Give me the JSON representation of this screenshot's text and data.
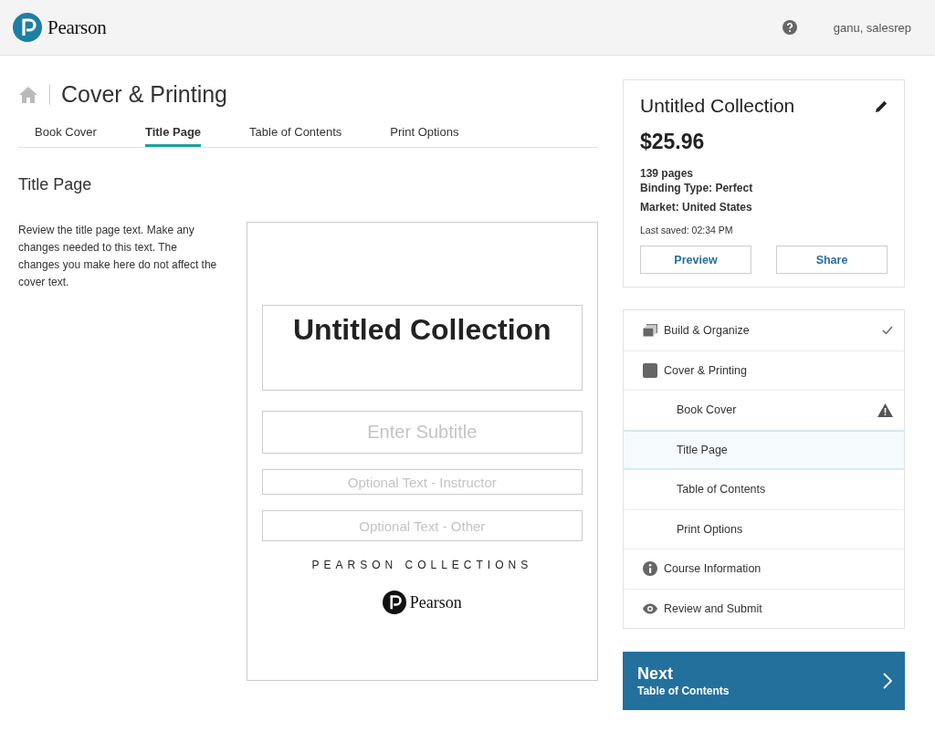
{
  "header": {
    "brand": "Pearson",
    "user": "ganu, salesrep"
  },
  "page": {
    "title": "Cover & Printing"
  },
  "tabs": [
    {
      "label": "Book Cover",
      "selected": false
    },
    {
      "label": "Title Page",
      "selected": true
    },
    {
      "label": "Table of Contents",
      "selected": false
    },
    {
      "label": "Print Options",
      "selected": false
    }
  ],
  "section": {
    "heading": "Title Page",
    "description": "Review the title page text. Make any changes needed to this text. The changes you make here do not affect the cover text."
  },
  "title_page": {
    "title": {
      "value": "Untitled Collection"
    },
    "subtitle": {
      "placeholder": "Enter Subtitle"
    },
    "instructor": {
      "placeholder": "Optional Text - Instructor"
    },
    "other": {
      "placeholder": "Optional Text - Other"
    },
    "imprint": "PEARSON COLLECTIONS",
    "brand": "Pearson"
  },
  "summary": {
    "title": "Untitled Collection",
    "price": "$25.96",
    "pages": "139 pages",
    "binding": "Binding Type: Perfect",
    "market": "Market: United States",
    "last_saved": "Last saved: 02:34 PM",
    "buttons": [
      "Preview",
      "Share"
    ]
  },
  "steps": [
    {
      "label": "Build & Organize",
      "kind": "section",
      "completed": true,
      "warning": false,
      "selected": false
    },
    {
      "label": "Cover & Printing",
      "kind": "section",
      "completed": false,
      "warning": false,
      "selected": false
    },
    {
      "label": "Book Cover",
      "kind": "sub",
      "completed": false,
      "warning": true,
      "selected": false
    },
    {
      "label": "Title Page",
      "kind": "sub",
      "completed": false,
      "warning": false,
      "selected": true
    },
    {
      "label": "Table of Contents",
      "kind": "sub",
      "completed": false,
      "warning": false,
      "selected": false
    },
    {
      "label": "Print Options",
      "kind": "sub",
      "completed": false,
      "warning": false,
      "selected": false
    },
    {
      "label": "Course Information",
      "kind": "section",
      "completed": false,
      "warning": false,
      "selected": false
    },
    {
      "label": "Review and Submit",
      "kind": "section",
      "completed": false,
      "warning": false,
      "selected": false
    }
  ],
  "next": {
    "label": "Next",
    "target": "Table of Contents"
  }
}
